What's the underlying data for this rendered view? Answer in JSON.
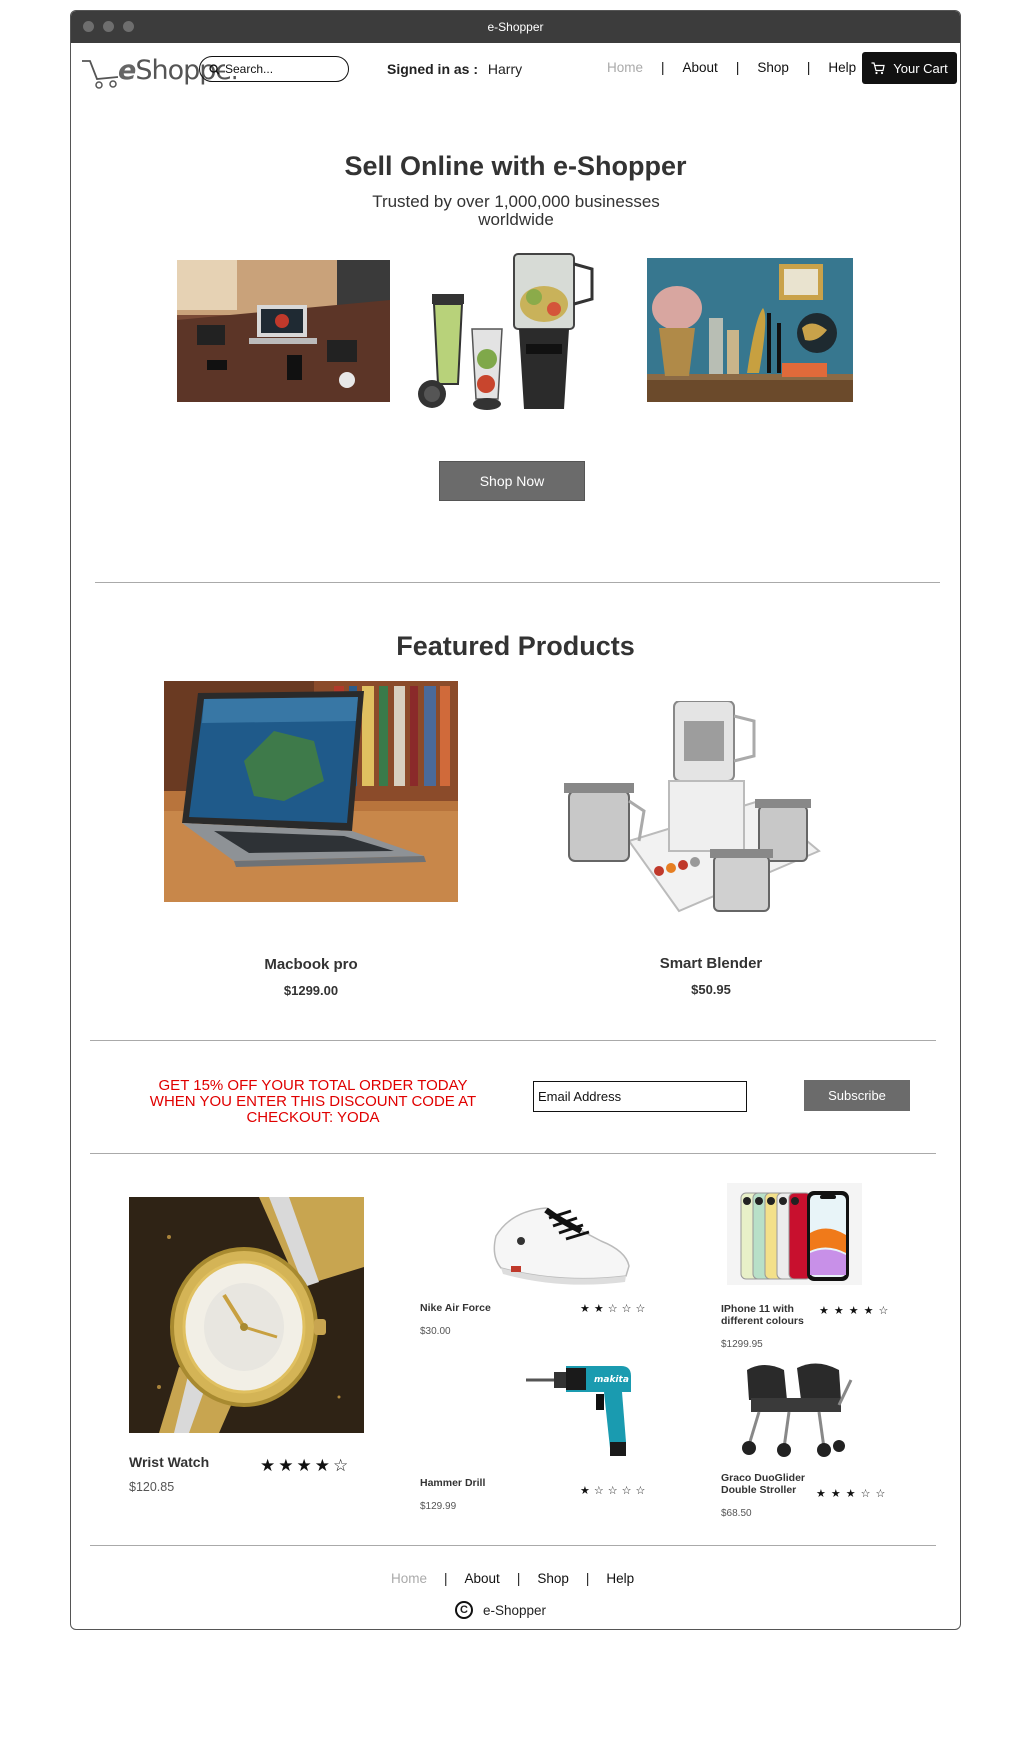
{
  "window": {
    "title": "e-Shopper"
  },
  "navbar": {
    "logo_e": "e",
    "logo_text": "Shopper",
    "search_placeholder": "Search...",
    "signed_label": "Signed in as :",
    "signed_user": "Harry",
    "links": [
      "Home",
      "About",
      "Shop",
      "Help"
    ],
    "active_link": "Home",
    "cart_label": "Your Cart"
  },
  "hero": {
    "title": "Sell Online with e-Shopper",
    "subtitle": "Trusted by over 1,000,000 businesses worldwide",
    "images": [
      "desk-workspace-photo",
      "blender-set-photo",
      "home-decor-shelf-photo"
    ],
    "cta_label": "Shop Now"
  },
  "featured": {
    "title": "Featured Products",
    "products": [
      {
        "name": "Macbook pro",
        "price": "$1299.00",
        "image": "macbook-photo"
      },
      {
        "name": "Smart Blender",
        "price": "$50.95",
        "image": "mixer-grinder-photo"
      }
    ]
  },
  "promo": {
    "text": "GET 15% OFF YOUR TOTAL ORDER TODAY WHEN YOU ENTER THIS DISCOUNT CODE AT CHECKOUT: YODA",
    "email_placeholder": "Email Address",
    "subscribe_label": "Subscribe",
    "text_color": "#e00000"
  },
  "products": [
    {
      "name": "Wrist Watch",
      "price": "$120.85",
      "rating": 4
    },
    {
      "name": "Nike Air Force",
      "price": "$30.00",
      "rating": 2
    },
    {
      "name": "IPhone 11 with different colours",
      "price": "$1299.95",
      "rating": 4
    },
    {
      "name": "Hammer Drill",
      "price": "$129.99",
      "rating": 1
    },
    {
      "name": "Graco DuoGlider Double Stroller",
      "price": "$68.50",
      "rating": 3
    }
  ],
  "footer": {
    "links": [
      "Home",
      "About",
      "Shop",
      "Help"
    ],
    "active_link": "Home",
    "copyright_symbol": "C",
    "brand": "e-Shopper"
  },
  "colors": {
    "button_gray": "#6b6b6b",
    "cart_bg": "#111111",
    "titlebar": "#3c3c3c"
  }
}
